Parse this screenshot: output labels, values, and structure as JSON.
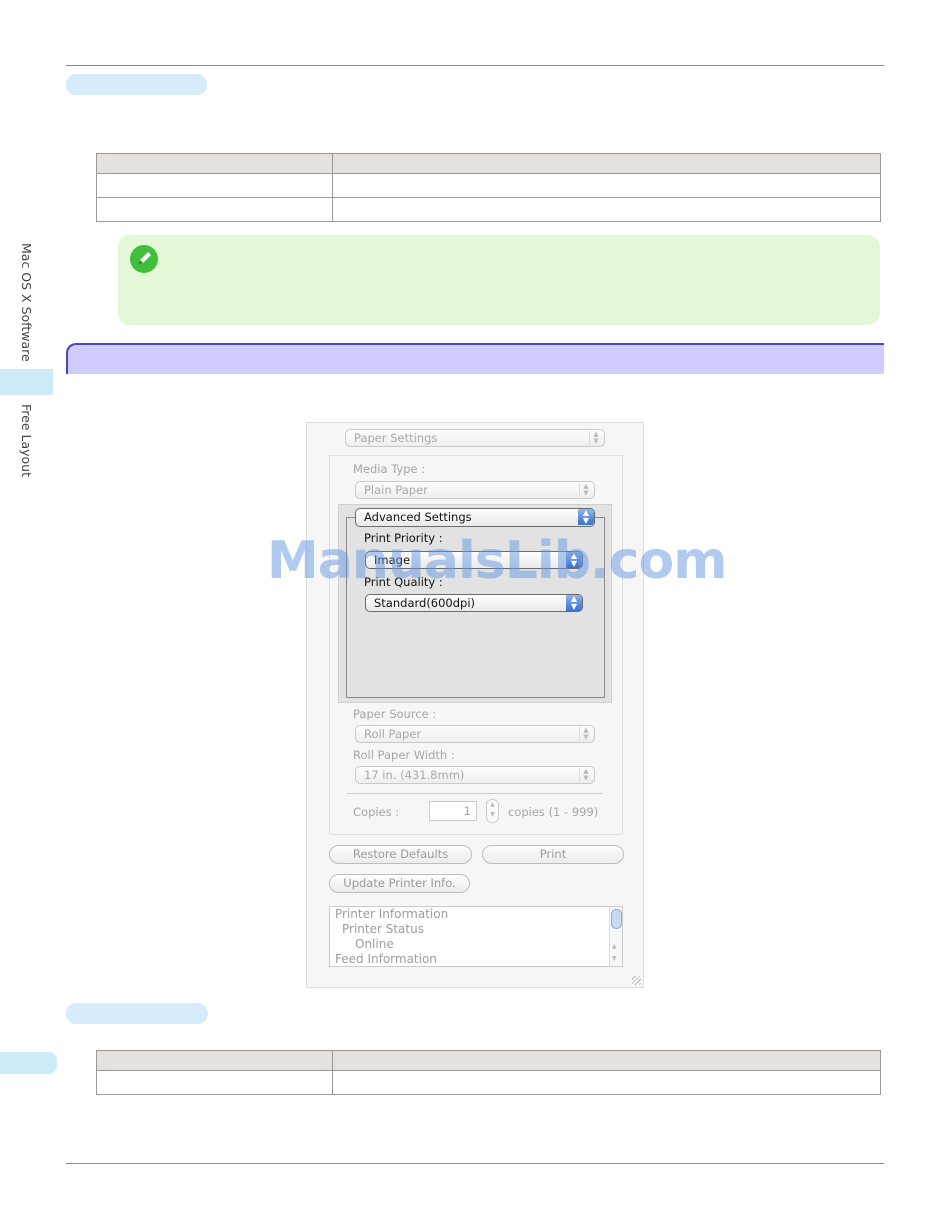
{
  "sidebar": {
    "section_label": "Mac OS X Software",
    "chapter_label": "Free Layout"
  },
  "dialog": {
    "panel_select": "Paper Settings",
    "media_type_label": "Media Type :",
    "media_type_value": "Plain Paper",
    "advanced_select": "Advanced Settings",
    "print_priority_label": "Print Priority :",
    "print_priority_value": "Image",
    "print_quality_label": "Print Quality :",
    "print_quality_value": "Standard(600dpi)",
    "paper_source_label": "Paper Source :",
    "paper_source_value": "Roll Paper",
    "roll_width_label": "Roll Paper Width :",
    "roll_width_value": "17 in. (431.8mm)",
    "copies_label": "Copies :",
    "copies_value": "1",
    "copies_range": "copies (1 - 999)",
    "restore_defaults_button": "Restore Defaults",
    "print_button": "Print",
    "update_printer_button": "Update Printer Info.",
    "info_list": [
      "Printer Information",
      "Printer Status",
      "Online",
      "Feed Information"
    ]
  },
  "watermark": "ManualsLib.com",
  "colors": {
    "tab_blue": "#cdebf8",
    "note_green": "#e4f8d8",
    "banner_purple": "#cfcdfd",
    "banner_border": "#4a42c8"
  },
  "icons": {
    "note": "pencil-icon"
  }
}
